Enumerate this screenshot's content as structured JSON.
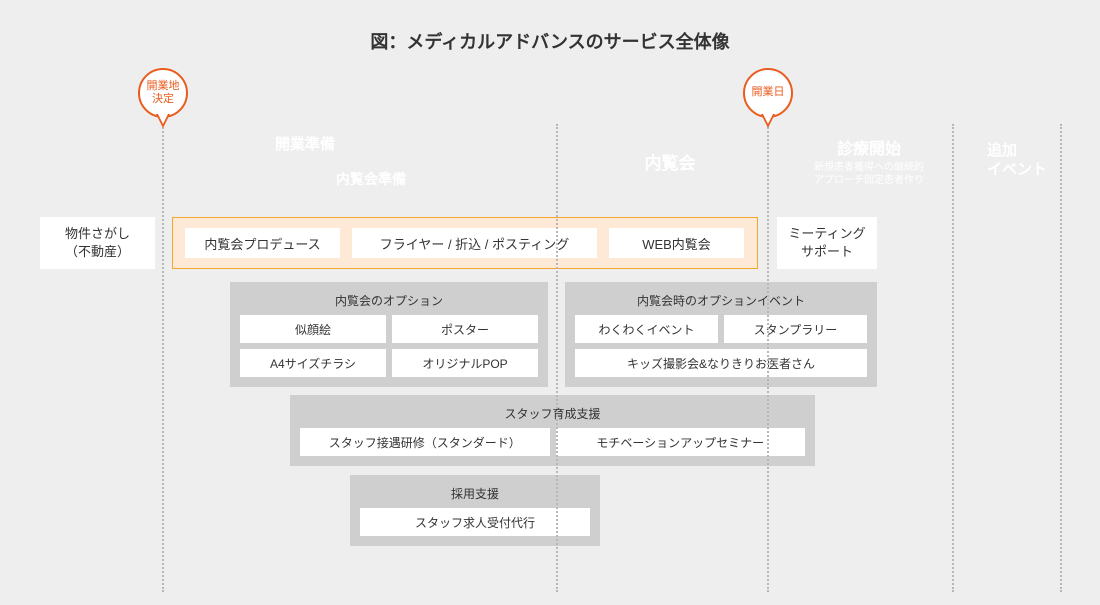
{
  "title": "図：メディカルアドバンスのサービス全体像",
  "pins": {
    "decision": "開業地\n決定",
    "openday": "開業日"
  },
  "arrows": {
    "prep": "開業準備",
    "previewPrep": "内覧会準備",
    "preview": "内覧会",
    "start": {
      "main": "診療開始",
      "sub": "新規患者獲得への継続的\nアプローチ固定患者作り"
    },
    "extra": "追加\nイベント"
  },
  "row1": {
    "left": "物件さがし\n（不動産）",
    "peach": {
      "a": "内覧会プロデュース",
      "b": "フライヤー / 折込 / ポスティング",
      "c": "WEB内覧会"
    },
    "right": "ミーティング\nサポート"
  },
  "optionsA": {
    "hd": "内覧会のオプション",
    "items": [
      "似顔絵",
      "ポスター",
      "A4サイズチラシ",
      "オリジナルPOP"
    ]
  },
  "optionsB": {
    "hd": "内覧会時のオプションイベント",
    "items": [
      "わくわくイベント",
      "スタンプラリー",
      "キッズ撮影会&なりきりお医者さん"
    ]
  },
  "staff": {
    "hd": "スタッフ育成支援",
    "items": [
      "スタッフ接遇研修（スタンダード）",
      "モチベーションアップセミナー"
    ]
  },
  "recruit": {
    "hd": "採用支援",
    "item": "スタッフ求人受付代行"
  }
}
